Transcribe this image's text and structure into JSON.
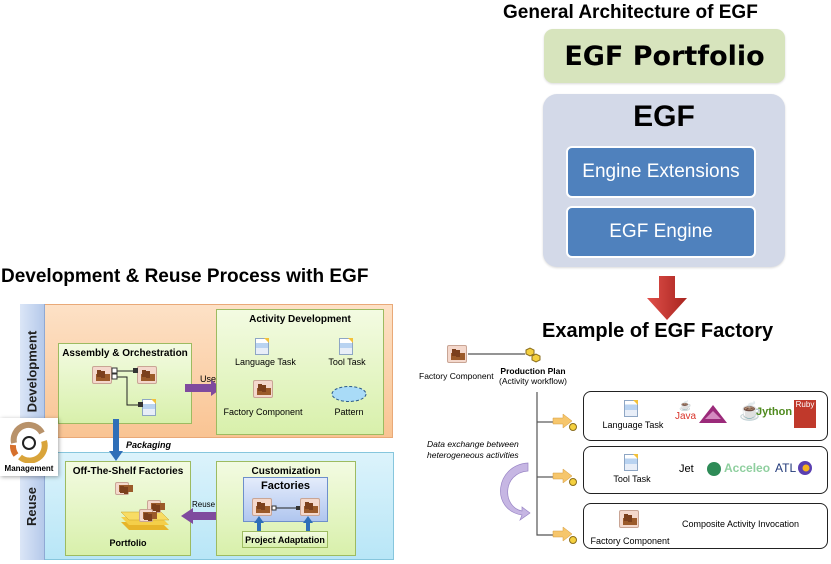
{
  "architecture": {
    "title": "General Architecture of EGF",
    "portfolio_label": "EGF Portfolio",
    "egf_label": "EGF",
    "layers": [
      "Engine Extensions",
      "EGF Engine"
    ],
    "colors": {
      "portfolio": "#d7e4bd",
      "egf_container": "#d3d9e8",
      "layer": "#4f81bd",
      "arrow": "#c0392b"
    }
  },
  "process": {
    "title": "Development & Reuse Process with EGF",
    "bands": {
      "development": "Development",
      "reuse": "Reuse"
    },
    "management_label": "Management",
    "assembly": {
      "title": "Assembly & Orchestration"
    },
    "activity_development": {
      "title": "Activity Development",
      "items": [
        "Language Task",
        "Tool Task",
        "Factory Component",
        "Pattern"
      ]
    },
    "use_label": "Use",
    "packaging_label": "Packaging",
    "off_the_shelf": {
      "title": "Off-The-Shelf Factories",
      "portfolio_label": "Portfolio"
    },
    "reuse_label": "Reuse",
    "customization": {
      "title": "Customization",
      "factories_label": "Factories",
      "project_adaptation_label": "Project Adaptation"
    }
  },
  "factory_example": {
    "title": "Example of EGF Factory",
    "factory_component_label": "Factory Component",
    "production_plan_label": "Production Plan",
    "production_plan_sub": "(Activity workflow)",
    "data_exchange_label": [
      "Data exchange between",
      "heterogeneous activities"
    ],
    "rows": [
      {
        "label": "Language Task",
        "logos": [
          "Java",
          "Kermeta",
          "Jython",
          "Ruby"
        ]
      },
      {
        "label": "Tool Task",
        "logos": [
          "Jet",
          "Acceleo",
          "ATL"
        ]
      },
      {
        "label": "Factory Component",
        "description": "Composite Activity Invocation"
      }
    ]
  }
}
